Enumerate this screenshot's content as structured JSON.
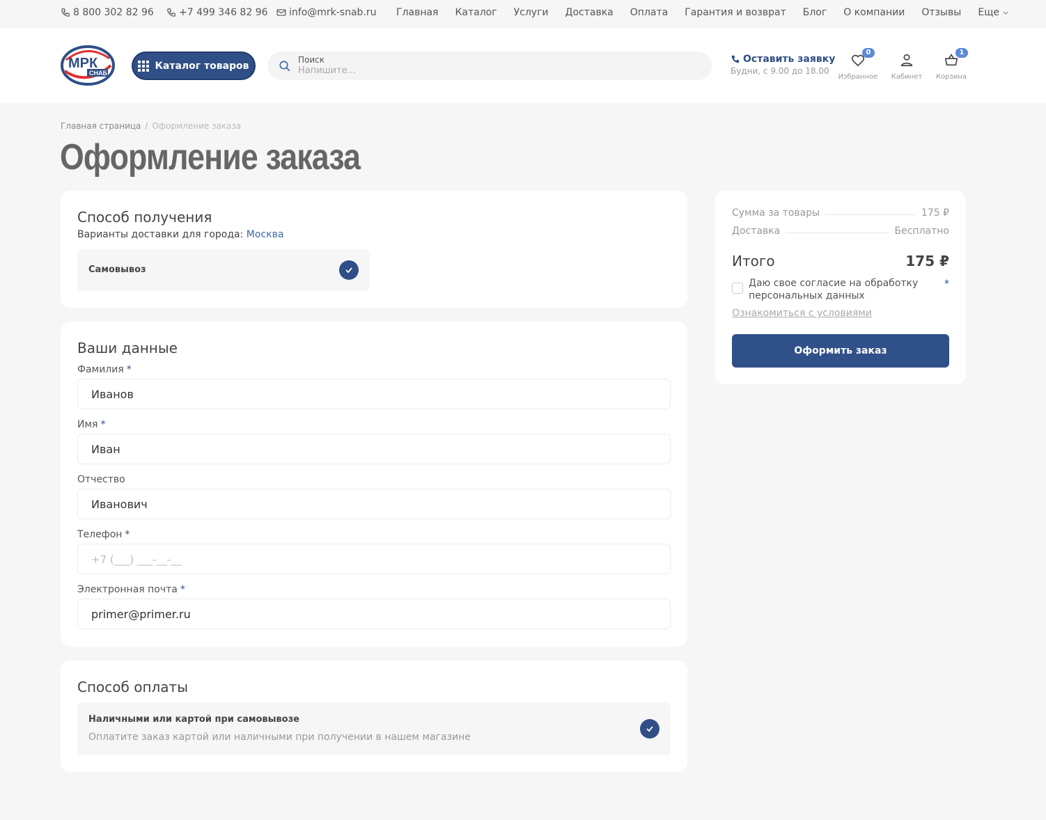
{
  "topbar": {
    "phone1": "8 800 302 82 96",
    "phone2": "+7 499 346 82 96",
    "email": "info@mrk-snab.ru",
    "nav": [
      "Главная",
      "Каталог",
      "Услуги",
      "Доставка",
      "Оплата",
      "Гарантия и возврат",
      "Блог",
      "О компании",
      "Отзывы"
    ],
    "more": "Еще"
  },
  "header": {
    "logo_text": "МРК",
    "logo_sub": "СНАБ",
    "catalog_button": "Каталог товаров",
    "search_label": "Поиск",
    "search_placeholder": "Напишите...",
    "request_title": "Оставить заявку",
    "request_hours": "Будни, с 9.00 до 18.00",
    "favorites_label": "Избранное",
    "favorites_count": "0",
    "cabinet_label": "Кабинет",
    "cart_label": "Корзина",
    "cart_count": "1"
  },
  "breadcrumb": {
    "home": "Главная страница",
    "sep": "/",
    "current": "Оформление заказа"
  },
  "page_title": "Оформление заказа",
  "delivery": {
    "title": "Способ получения",
    "city_prefix": "Варианты доставки для города:",
    "city": "Москва",
    "option": "Самовывоз"
  },
  "personal": {
    "title": "Ваши данные",
    "fields": [
      {
        "label": "Фамилия",
        "required": "*",
        "value": "Иванов",
        "placeholder": ""
      },
      {
        "label": "Имя",
        "required": "*",
        "value": "Иван",
        "placeholder": ""
      },
      {
        "label": "Отчество",
        "required": "",
        "value": "Иванович",
        "placeholder": ""
      },
      {
        "label": "Телефон",
        "required": "*",
        "value": "",
        "placeholder": "+7 (___) ___-__-__"
      },
      {
        "label": "Электронная почта",
        "required": "*",
        "value": "primer@primer.ru",
        "placeholder": ""
      }
    ]
  },
  "payment": {
    "title": "Способ оплаты",
    "option_title": "Наличными или картой при самовывозе",
    "option_desc": "Оплатите заказ картой или наличными при получении в нашем магазине"
  },
  "summary": {
    "goods_label": "Сумма за товары",
    "goods_value": "175 ₽",
    "delivery_label": "Доставка",
    "delivery_value": "Бесплатно",
    "total_label": "Итого",
    "total_value": "175 ₽",
    "consent_text": "Даю свое согласие на обработку персональных данных",
    "consent_required": "*",
    "terms_link": "Ознакомиться с условиями",
    "submit": "Оформить заказ"
  },
  "colors": {
    "accent": "#2f4f86",
    "background": "#f6f6f6",
    "badge": "#5b8ad6"
  }
}
